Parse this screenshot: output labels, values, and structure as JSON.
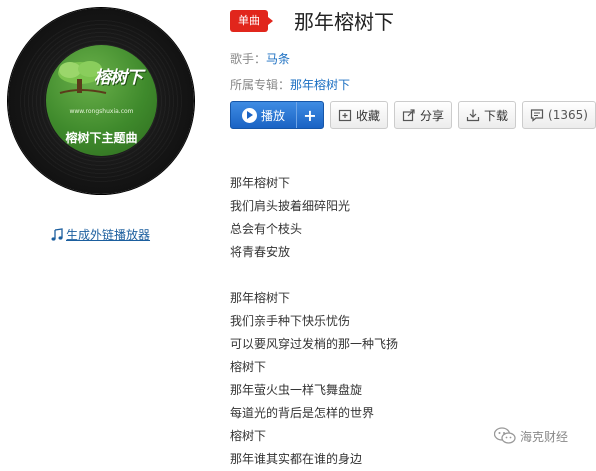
{
  "album_cover": {
    "logo_text": "榕树下",
    "site_url": "www.rongshuxia.com",
    "caption": "榕树下主题曲"
  },
  "player_link": {
    "label": "生成外链播放器",
    "icon": "music-note-icon"
  },
  "header": {
    "badge": "单曲",
    "title": "那年榕树下"
  },
  "meta": {
    "singer_label": "歌手：",
    "singer": "马条",
    "album_label": "所属专辑：",
    "album": "那年榕树下"
  },
  "actions": {
    "play": "播放",
    "add": "+",
    "favorite": "收藏",
    "share": "分享",
    "download": "下载",
    "comments": "(1365)"
  },
  "lyrics": [
    "那年榕树下",
    "我们肩头披着细碎阳光",
    "总会有个枝头",
    "将青春安放",
    "",
    "那年榕树下",
    "我们亲手种下快乐忧伤",
    "可以要风穿过发梢的那一种飞扬",
    "榕树下",
    "那年萤火虫一样飞舞盘旋",
    "每道光的背后是怎样的世界",
    "榕树下",
    "那年谁其实都在谁的身边"
  ],
  "watermark": {
    "text": "海克财经"
  },
  "colors": {
    "badge_red": "#e1261c",
    "link_blue": "#1b6fc2",
    "play_blue": "#1a63c4",
    "cover_green": "#3f8a2c"
  }
}
